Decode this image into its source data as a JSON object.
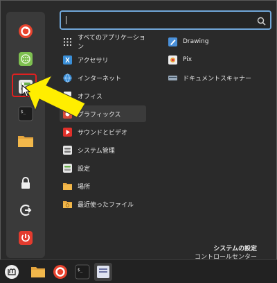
{
  "search": {
    "value": "",
    "placeholder": ""
  },
  "categories": [
    {
      "label": "すべてのアプリケーション",
      "icon": "grid-icon"
    },
    {
      "label": "アクセサリ",
      "icon": "accessories-icon"
    },
    {
      "label": "インターネット",
      "icon": "globe-icon"
    },
    {
      "label": "オフィス",
      "icon": "office-icon"
    },
    {
      "label": "グラフィックス",
      "icon": "graphics-icon"
    },
    {
      "label": "サウンドとビデオ",
      "icon": "video-icon"
    },
    {
      "label": "システム管理",
      "icon": "settings-icon"
    },
    {
      "label": "設定",
      "icon": "preferences-icon"
    },
    {
      "label": "場所",
      "icon": "folder-icon"
    },
    {
      "label": "最近使ったファイル",
      "icon": "recent-files-icon"
    }
  ],
  "apps": [
    {
      "label": "Drawing",
      "icon": "drawing-icon"
    },
    {
      "label": "Pix",
      "icon": "pix-icon"
    },
    {
      "label": "ドキュメントスキャナー",
      "icon": "scanner-icon"
    }
  ],
  "description": {
    "title": "システムの設定",
    "text": "コントロールセンター"
  },
  "favorites": [
    {
      "name": "firefox-icon"
    },
    {
      "name": "software-manager-icon"
    },
    {
      "name": "system-settings-icon"
    },
    {
      "name": "terminal-icon"
    },
    {
      "name": "files-icon"
    },
    {
      "name": "lock-icon"
    },
    {
      "name": "logout-icon"
    },
    {
      "name": "power-icon"
    }
  ],
  "taskbar": [
    {
      "name": "menu-icon"
    },
    {
      "name": "files-icon"
    },
    {
      "name": "firefox-icon"
    },
    {
      "name": "terminal-icon"
    },
    {
      "name": "active-window-icon"
    }
  ],
  "colors": {
    "accent": "#70a6d8",
    "highlight_border": "#e02020",
    "arrow": "#ffee00"
  }
}
